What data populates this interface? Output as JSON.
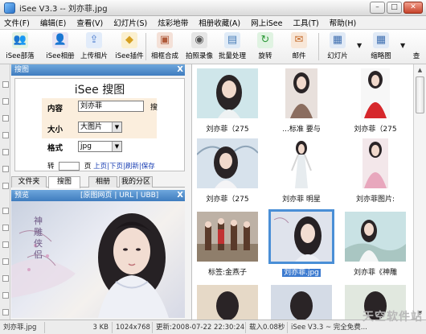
{
  "window": {
    "title": "iSee V3.3 -- 刘亦菲.jpg",
    "buttons": {
      "minimize": "–",
      "maximize": "□",
      "close": "✕"
    }
  },
  "menu": [
    "文件(F)",
    "编辑(E)",
    "查看(V)",
    "幻灯片(S)",
    "炫彩地带",
    "相册收藏(A)",
    "网上iSee",
    "工具(T)",
    "帮助(H)"
  ],
  "toolbar": [
    {
      "label": "iSee部落",
      "icon": "people-icon",
      "glyph": "👥",
      "color": "#3a8a3a"
    },
    {
      "label": "iSee相册",
      "icon": "album-icon",
      "glyph": "👤",
      "color": "#6b5c9a"
    },
    {
      "label": "上传相片",
      "icon": "upload-icon",
      "glyph": "⇪",
      "color": "#4f7fd0"
    },
    {
      "label": "iSee插件",
      "icon": "plugin-icon",
      "glyph": "◆",
      "color": "#d6a021"
    },
    {
      "label": "相框合成",
      "icon": "frame-icon",
      "glyph": "▣",
      "color": "#b05a3a"
    },
    {
      "label": "拍照录像",
      "icon": "webcam-icon",
      "glyph": "◉",
      "color": "#555555"
    },
    {
      "label": "批量处理",
      "icon": "batch-icon",
      "glyph": "▤",
      "color": "#4a7fb8"
    },
    {
      "label": "旋转",
      "icon": "rotate-icon",
      "glyph": "↻",
      "color": "#2f9a3a"
    },
    {
      "label": "邮件",
      "icon": "mail-icon",
      "glyph": "✉",
      "color": "#c46a2a"
    },
    {
      "label": "幻灯片",
      "icon": "slideshow-icon",
      "glyph": "▦",
      "color": "#3f6fb0"
    },
    {
      "label": "缩略图",
      "icon": "thumbnails-icon",
      "glyph": "▦",
      "color": "#3f6fb0"
    },
    {
      "label": "查",
      "icon": "view-icon",
      "glyph": "",
      "color": "#333333"
    }
  ],
  "search_panel": {
    "header": "搜图",
    "title": "iSee 搜图",
    "content_label": "内容",
    "content_value": "刘亦菲",
    "search_button": "搜",
    "size_label": "大小",
    "size_value": "大图片",
    "format_label": "格式",
    "format_value": "jpg",
    "pager_prefix": "转",
    "pager_unit": "页",
    "pager_links": "上页|下页|刷新|保存"
  },
  "tabs": [
    "文件夹",
    "搜图",
    "相册",
    "我的分区"
  ],
  "active_tab": 1,
  "preview": {
    "header": "预览",
    "links": "[原图网页 | URL | UBB]",
    "calligraphy": "神雕侠侣"
  },
  "thumbnails": [
    {
      "caption": "刘亦菲（275"
    },
    {
      "caption": "...标准 要与"
    },
    {
      "caption": "刘亦菲（275"
    },
    {
      "caption": "刘亦菲（275"
    },
    {
      "caption": "刘亦菲 明星"
    },
    {
      "caption": "刘亦菲图片:"
    },
    {
      "caption": "标签:金燕子"
    },
    {
      "caption": "刘亦菲.jpg",
      "selected": true
    },
    {
      "caption": "刘亦菲《神雕"
    }
  ],
  "status": [
    "刘亦菲.jpg",
    "3 KB",
    "1024x768",
    "更新:2008-07-22 22:30:24",
    "载入0.08秒",
    "iSee V3.3 ~ 完全免费..."
  ],
  "watermark": "天空软件站"
}
